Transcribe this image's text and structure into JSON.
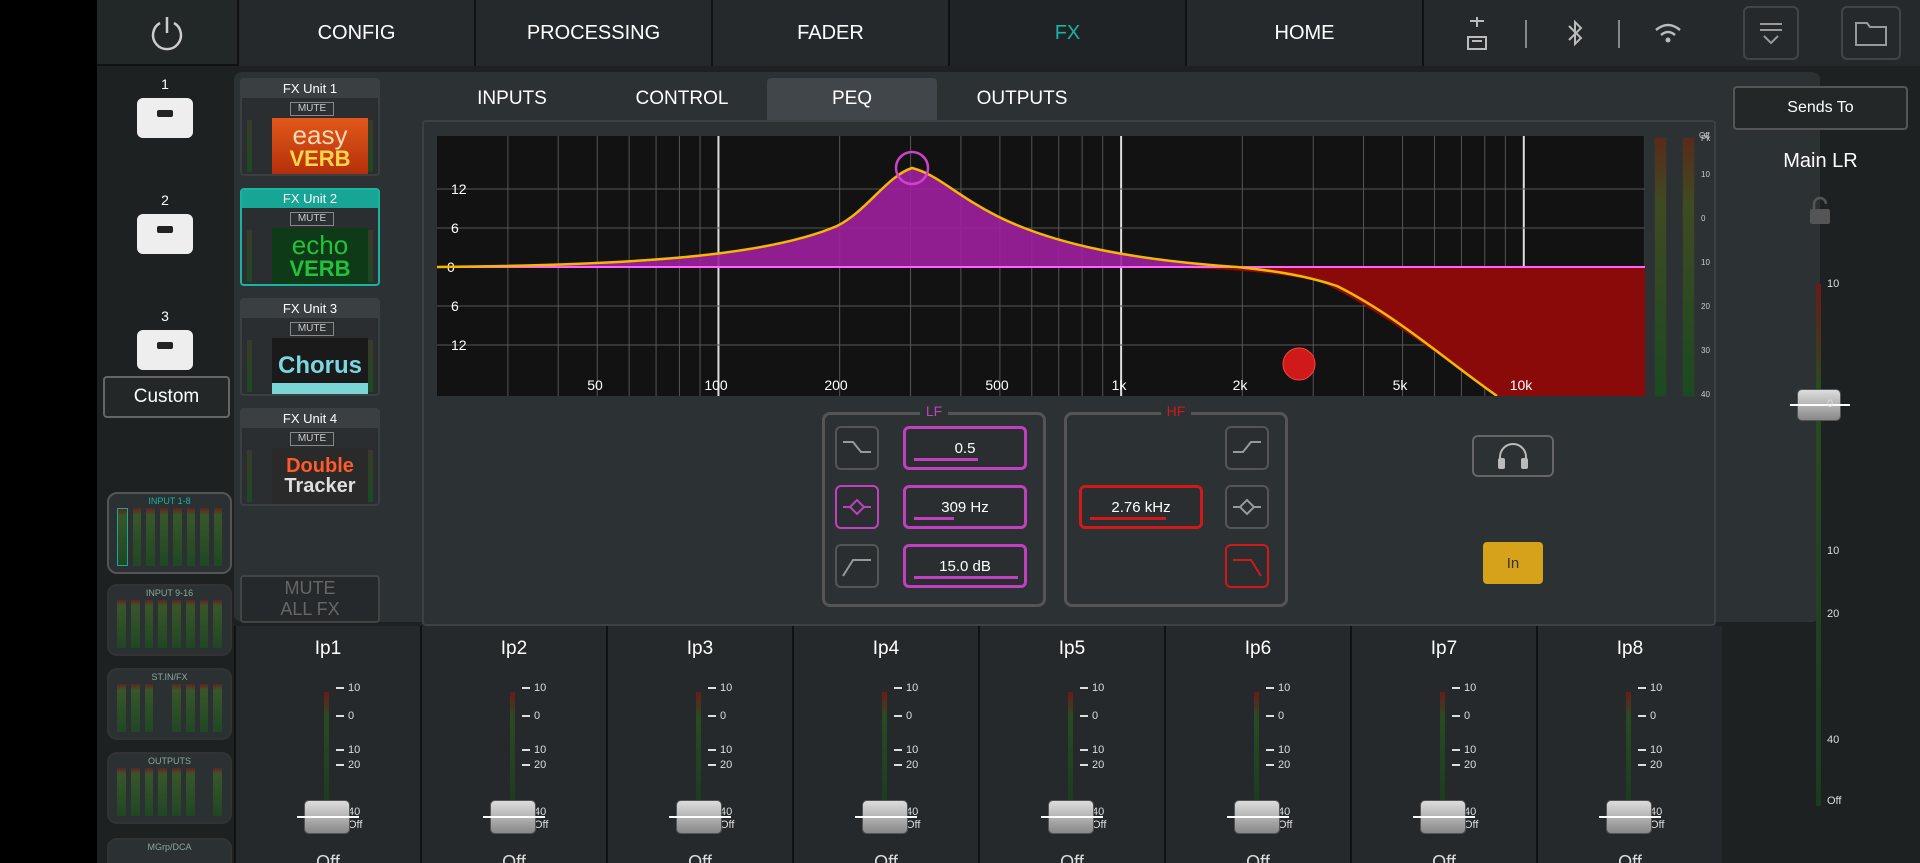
{
  "topbar": {
    "nav": [
      "CONFIG",
      "PROCESSING",
      "FADER",
      "FX",
      "HOME"
    ],
    "active_nav": "FX"
  },
  "left": {
    "mute_groups": [
      "1",
      "2",
      "3"
    ],
    "custom_label": "Custom",
    "meter_blocks": [
      "INPUT 1-8",
      "INPUT 9-16",
      "ST.IN/FX",
      "OUTPUTS",
      "MGrp/DCA"
    ]
  },
  "fx": {
    "units": [
      {
        "title": "FX Unit 1",
        "mute": "MUTE",
        "art_line1": "easy",
        "art_line2": "VERB"
      },
      {
        "title": "FX Unit 2",
        "mute": "MUTE",
        "art_line1": "echo",
        "art_line2": "VERB"
      },
      {
        "title": "FX Unit 3",
        "mute": "MUTE",
        "art_line1": "Chorus",
        "art_line2": ""
      },
      {
        "title": "FX Unit 4",
        "mute": "MUTE",
        "art_line1": "Double",
        "art_line2": "Tracker"
      }
    ],
    "mute_all_line1": "MUTE",
    "mute_all_line2": "ALL FX"
  },
  "tabs": [
    "INPUTS",
    "CONTROL",
    "PEQ",
    "OUTPUTS"
  ],
  "active_tab": "PEQ",
  "peq": {
    "graph": {
      "freq_labels": [
        "50",
        "100",
        "200",
        "500",
        "1k",
        "2k",
        "5k",
        "10k"
      ],
      "gain_labels": [
        "12",
        "6",
        "0",
        "6",
        "12"
      ],
      "meter_scale": [
        "Pk",
        "10",
        "0",
        "10",
        "20",
        "30",
        "40"
      ]
    },
    "lf": {
      "label": "LF",
      "q": "0.5",
      "freq": "309 Hz",
      "gain": "15.0 dB"
    },
    "hf": {
      "label": "HF",
      "freq": "2.76 kHz"
    },
    "in_label": "In"
  },
  "right": {
    "sends_to": "Sends To",
    "main_label": "Main LR",
    "scale": [
      "10",
      "0",
      "10",
      "20",
      "40",
      "Off"
    ]
  },
  "strips": {
    "names": [
      "Ip1",
      "Ip2",
      "Ip3",
      "Ip4",
      "Ip5",
      "Ip6",
      "Ip7",
      "Ip8"
    ],
    "scale": [
      "10",
      "0",
      "10",
      "20",
      "40",
      "Off"
    ],
    "level": "Off"
  },
  "colors": {
    "accent": "#19b3a3",
    "lf": "#c040c0",
    "hf": "#d01a1a",
    "curve": "#f5b800",
    "in": "#d6a21a"
  }
}
